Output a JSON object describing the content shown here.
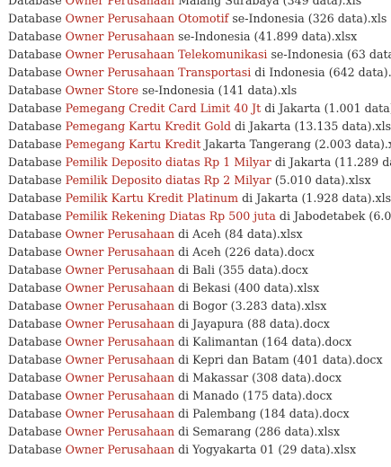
{
  "rows": [
    {
      "prefix": "Database ",
      "link": "Owner Perusahaan",
      "rest": " Malang Surabaya (349 data).xls"
    },
    {
      "prefix": "Database ",
      "link": "Owner Perusahaan Otomotif",
      "rest": " se-Indonesia (326 data).xls"
    },
    {
      "prefix": "Database ",
      "link": "Owner Perusahaan",
      "rest": " se-Indonesia (41.899 data).xlsx"
    },
    {
      "prefix": "Database ",
      "link": "Owner Perusahaan Telekomunikasi",
      "rest": " se-Indonesia (63 data).x"
    },
    {
      "prefix": "Database ",
      "link": "Owner Perusahaan Transportasi",
      "rest": " di Indonesia (642 data).xls"
    },
    {
      "prefix": "Database ",
      "link": "Owner Store",
      "rest": " se-Indonesia (141 data).xls"
    },
    {
      "prefix": "Database ",
      "link": "Pemegang Credit Card Limit 40 Jt",
      "rest": " di Jakarta (1.001 data).xl"
    },
    {
      "prefix": "Database ",
      "link": "Pemegang Kartu Kredit Gold",
      "rest": " di Jakarta (13.135 data).xlsx"
    },
    {
      "prefix": "Database ",
      "link": "Pemegang Kartu Kredit",
      "rest": " Jakarta Tangerang (2.003 data).xls"
    },
    {
      "prefix": "Database ",
      "link": "Pemilik Deposito diatas Rp 1 Milyar",
      "rest": " di Jakarta (11.289 data"
    },
    {
      "prefix": "Database ",
      "link": "Pemilik Deposito diatas Rp 2 Milyar",
      "rest": " (5.010 data).xlsx"
    },
    {
      "prefix": "Database ",
      "link": "Pemilik Kartu Kredit Platinum",
      "rest": " di Jakarta (1.928 data).xlsx"
    },
    {
      "prefix": "Database ",
      "link": "Pemilik Rekening Diatas Rp 500 juta",
      "rest": " di Jabodetabek (6.007"
    },
    {
      "prefix": "Database ",
      "link": "Owner Perusahaan",
      "rest": " di Aceh (84 data).xlsx"
    },
    {
      "prefix": "Database ",
      "link": "Owner Perusahaan",
      "rest": " di Aceh (226 data).docx"
    },
    {
      "prefix": "Database ",
      "link": "Owner Perusahaan",
      "rest": " di Bali (355 data).docx"
    },
    {
      "prefix": "Database ",
      "link": "Owner Perusahaan",
      "rest": " di Bekasi (400 data).xlsx"
    },
    {
      "prefix": "Database ",
      "link": "Owner Perusahaan",
      "rest": " di Bogor (3.283 data).xlsx"
    },
    {
      "prefix": "Database ",
      "link": "Owner Perusahaan",
      "rest": " di Jayapura (88 data).docx"
    },
    {
      "prefix": "Database ",
      "link": "Owner Perusahaan",
      "rest": " di Kalimantan (164 data).docx"
    },
    {
      "prefix": "Database ",
      "link": "Owner Perusahaan",
      "rest": " di Kepri dan Batam (401 data).docx"
    },
    {
      "prefix": "Database ",
      "link": "Owner Perusahaan",
      "rest": " di Makassar (308 data).docx"
    },
    {
      "prefix": "Database ",
      "link": "Owner Perusahaan",
      "rest": " di Manado (175 data).docx"
    },
    {
      "prefix": "Database ",
      "link": "Owner Perusahaan",
      "rest": " di Palembang (184 data).docx"
    },
    {
      "prefix": "Database ",
      "link": "Owner Perusahaan",
      "rest": " di Semarang (286 data).xlsx"
    },
    {
      "prefix": "Database ",
      "link": "Owner Perusahaan",
      "rest": " di Yogyakarta 01 (29 data).xlsx"
    }
  ],
  "colors": {
    "link": "#b0281e",
    "text": "#333333",
    "background": "#ffffff"
  }
}
